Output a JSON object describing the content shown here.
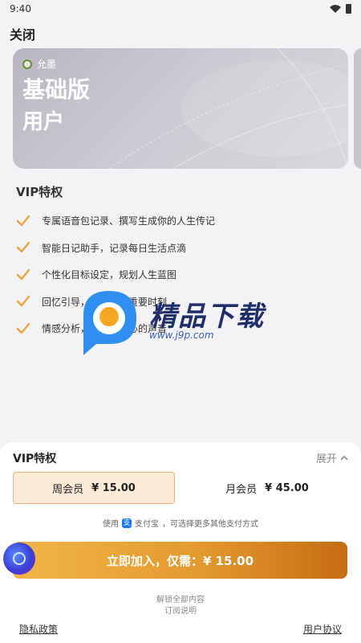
{
  "status_bar": {
    "time": "9:40"
  },
  "header": {
    "close_label": "关闭"
  },
  "plan_card": {
    "brand": "允墨",
    "title": "基础版",
    "subtitle": "用户"
  },
  "benefits": {
    "heading": "VIP特权",
    "items": [
      "专属语音包记录、撰写生成你的人生传记",
      "智能日记助手，记录每日生活点滴",
      "个性化目标设定，规划人生蓝图",
      "回忆引导，记录人生重要时刻",
      "情感分析，理解你内心的声音"
    ]
  },
  "watermark": {
    "title": "精品下载",
    "url": "www.j9p.com"
  },
  "sheet": {
    "title": "VIP特权",
    "expand_label": "展开",
    "plans": [
      {
        "label": "周会员",
        "price": "¥ 15.00",
        "selected": true
      },
      {
        "label": "月会员",
        "price": "¥ 45.00",
        "selected": false
      }
    ],
    "pay_note_prefix": "使用",
    "pay_method": "支付宝",
    "pay_note_suffix": "，可选择更多其他支付方式",
    "join_button": "立即加入，仅需：¥ 15.00",
    "unlock_text": "解锁全部内容",
    "subscription_note": "订阅说明",
    "privacy_link": "隐私政策",
    "agreement_link": "用户协议"
  },
  "colors": {
    "accent": "#f0a33a",
    "check": "#f0a33a",
    "selected_bg": "#fdebd8"
  },
  "icons": {
    "check": "check-icon",
    "wifi": "wifi-icon",
    "battery": "battery-icon",
    "chevron": "chevron-up-icon"
  }
}
